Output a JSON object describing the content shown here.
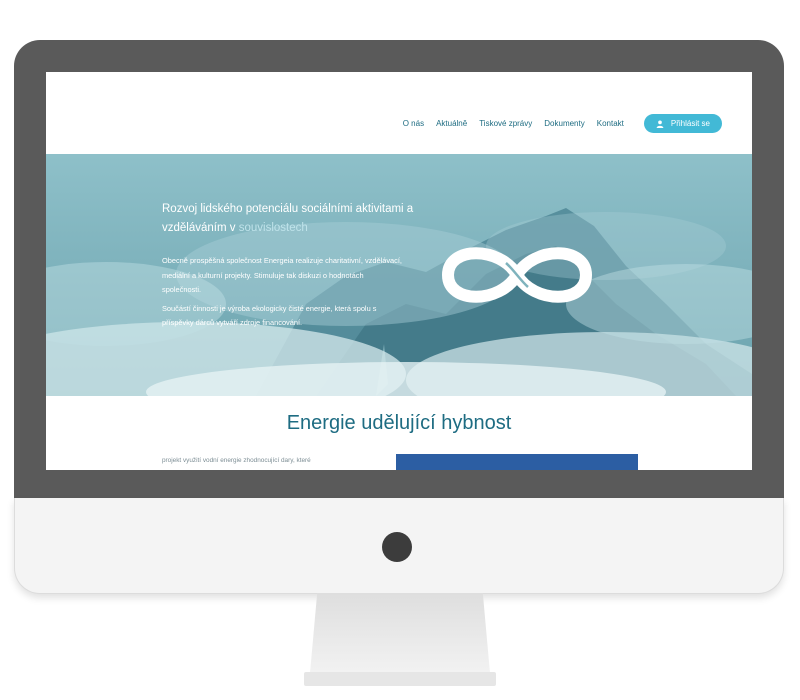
{
  "nav": {
    "items": [
      "O nás",
      "Aktuálně",
      "Tiskové zprávy",
      "Dokumenty",
      "Kontakt"
    ],
    "login_label": "Přihlásit se"
  },
  "hero": {
    "heading_main": "Rozvoj lidského potenciálu sociálními aktivitami a vzděláváním v",
    "heading_accent": "souvislostech",
    "paragraph_1": "Obecně prospěšná společnost Energeia realizuje charitativní, vzdělávací, mediální a kulturní projekty. Stimuluje tak diskuzi o hodnotách společnosti.",
    "paragraph_2": "Součástí činnosti je výroba ekologicky čisté energie, která spolu s příspěvky dárců vytváří zdroje financování."
  },
  "section": {
    "title": "Energie udělující hybnost",
    "intro_text": "projekt využití vodní energie zhodnocující dary, které"
  },
  "colors": {
    "accent": "#42b9d6",
    "heading_teal": "#1e6c82",
    "hero_bg": "#7fb3bd",
    "panel_blue": "#2c5ea3",
    "bezel": "#5a5a5a"
  },
  "icons": [
    "user-icon",
    "infinity-logo-icon",
    "power-button-icon"
  ]
}
